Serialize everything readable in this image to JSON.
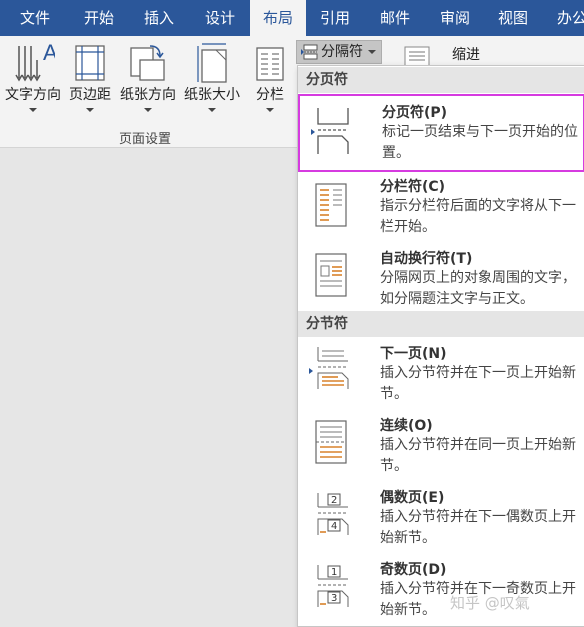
{
  "tabs": [
    "文件",
    "开始",
    "插入",
    "设计",
    "布局",
    "引用",
    "邮件",
    "审阅",
    "视图",
    "办公"
  ],
  "active_tab": "布局",
  "ribbon": {
    "buttons": [
      {
        "label": "文字方向",
        "icon": "text-direction-icon"
      },
      {
        "label": "页边距",
        "icon": "margins-icon"
      },
      {
        "label": "纸张方向",
        "icon": "orientation-icon"
      },
      {
        "label": "纸张大小",
        "icon": "size-icon"
      },
      {
        "label": "分栏",
        "icon": "columns-icon"
      }
    ],
    "group_label": "页面设置",
    "breaks_label": "分隔符",
    "indent_label": "缩进"
  },
  "breaks_menu": {
    "page_breaks_header": "分页符",
    "section_breaks_header": "分节符",
    "items": [
      {
        "title": "分页符(P)",
        "desc": "标记一页结束与下一页开始的位置。",
        "icon": "page-break-icon"
      },
      {
        "title": "分栏符(C)",
        "desc": "指示分栏符后面的文字将从下一栏开始。",
        "icon": "column-break-icon"
      },
      {
        "title": "自动换行符(T)",
        "desc": "分隔网页上的对象周围的文字，如分隔题注文字与正文。",
        "icon": "text-wrapping-icon"
      },
      {
        "title": "下一页(N)",
        "desc": "插入分节符并在下一页上开始新节。",
        "icon": "next-page-icon"
      },
      {
        "title": "连续(O)",
        "desc": "插入分节符并在同一页上开始新节。",
        "icon": "continuous-icon"
      },
      {
        "title": "偶数页(E)",
        "desc": "插入分节符并在下一偶数页上开始新节。",
        "icon": "even-page-icon"
      },
      {
        "title": "奇数页(D)",
        "desc": "插入分节符并在下一奇数页上开始新节。",
        "icon": "odd-page-icon"
      }
    ]
  },
  "watermark": "知乎 @叹氣",
  "colors": {
    "accent": "#2b579a",
    "highlight": "#d63be0",
    "icon_orange": "#d9822b"
  }
}
